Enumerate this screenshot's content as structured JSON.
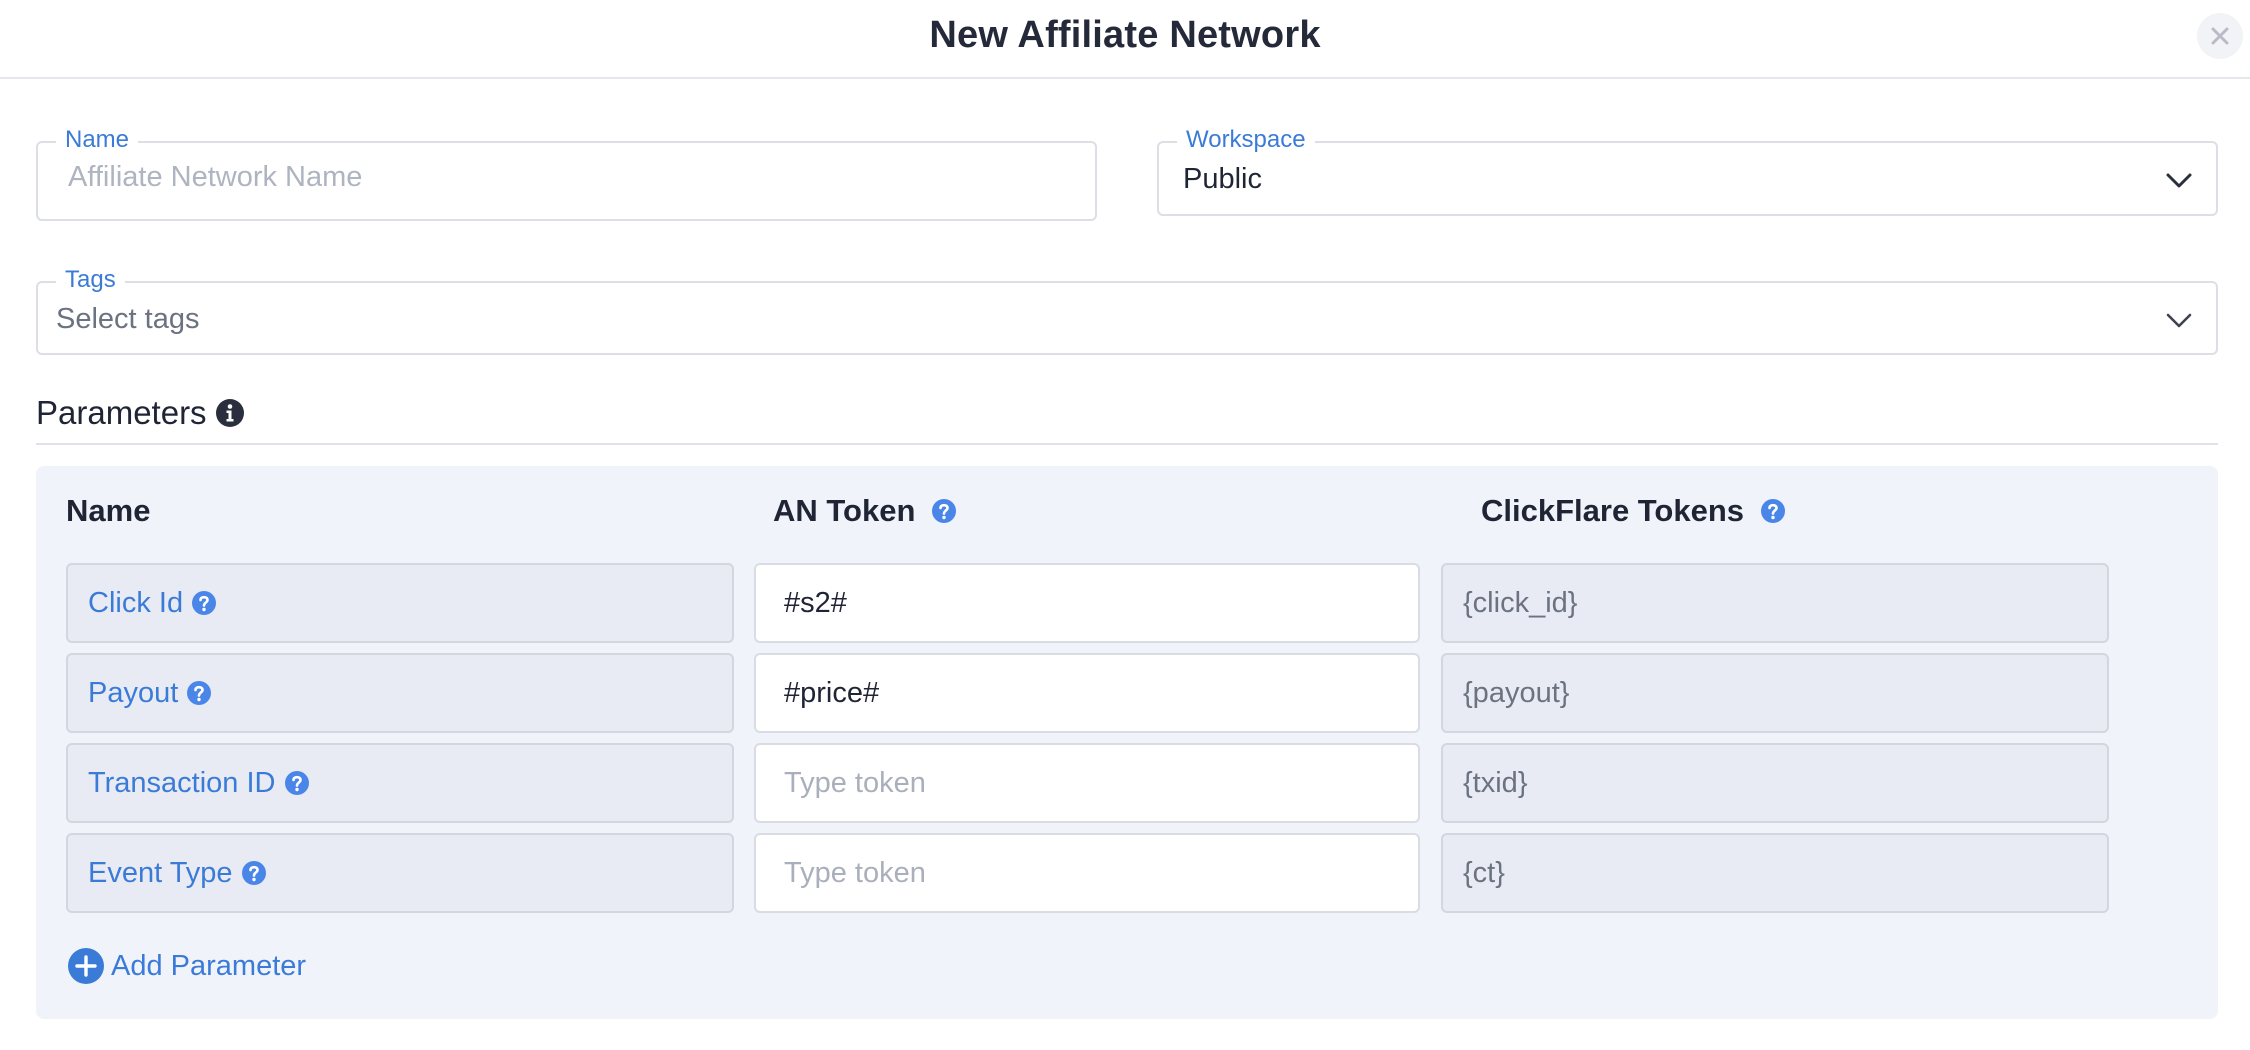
{
  "modal": {
    "title": "New Affiliate Network",
    "close_icon": "close-icon"
  },
  "form": {
    "name": {
      "label": "Name",
      "value": "",
      "placeholder": "Affiliate Network Name"
    },
    "workspace": {
      "label": "Workspace",
      "value": "Public"
    },
    "tags": {
      "label": "Tags",
      "placeholder": "Select tags"
    }
  },
  "parameters": {
    "title": "Parameters",
    "columns": {
      "name": "Name",
      "an_token": "AN Token",
      "clickflare_tokens": "ClickFlare Tokens"
    },
    "rows": [
      {
        "name": "Click Id",
        "an_token": "#s2#",
        "an_token_placeholder": "Type token",
        "clickflare_token": "{click_id}"
      },
      {
        "name": "Payout",
        "an_token": "#price#",
        "an_token_placeholder": "Type token",
        "clickflare_token": "{payout}"
      },
      {
        "name": "Transaction ID",
        "an_token": "",
        "an_token_placeholder": "Type token",
        "clickflare_token": "{txid}"
      },
      {
        "name": "Event Type",
        "an_token": "",
        "an_token_placeholder": "Type token",
        "clickflare_token": "{ct}"
      }
    ],
    "add_label": "Add Parameter"
  },
  "colors": {
    "accent": "#3b7bd8",
    "help_icon": "#4a86e8",
    "title_text": "#252a3a",
    "panel_bg": "#f1f3fb",
    "readonly_cell_bg": "#e8ebf3"
  }
}
